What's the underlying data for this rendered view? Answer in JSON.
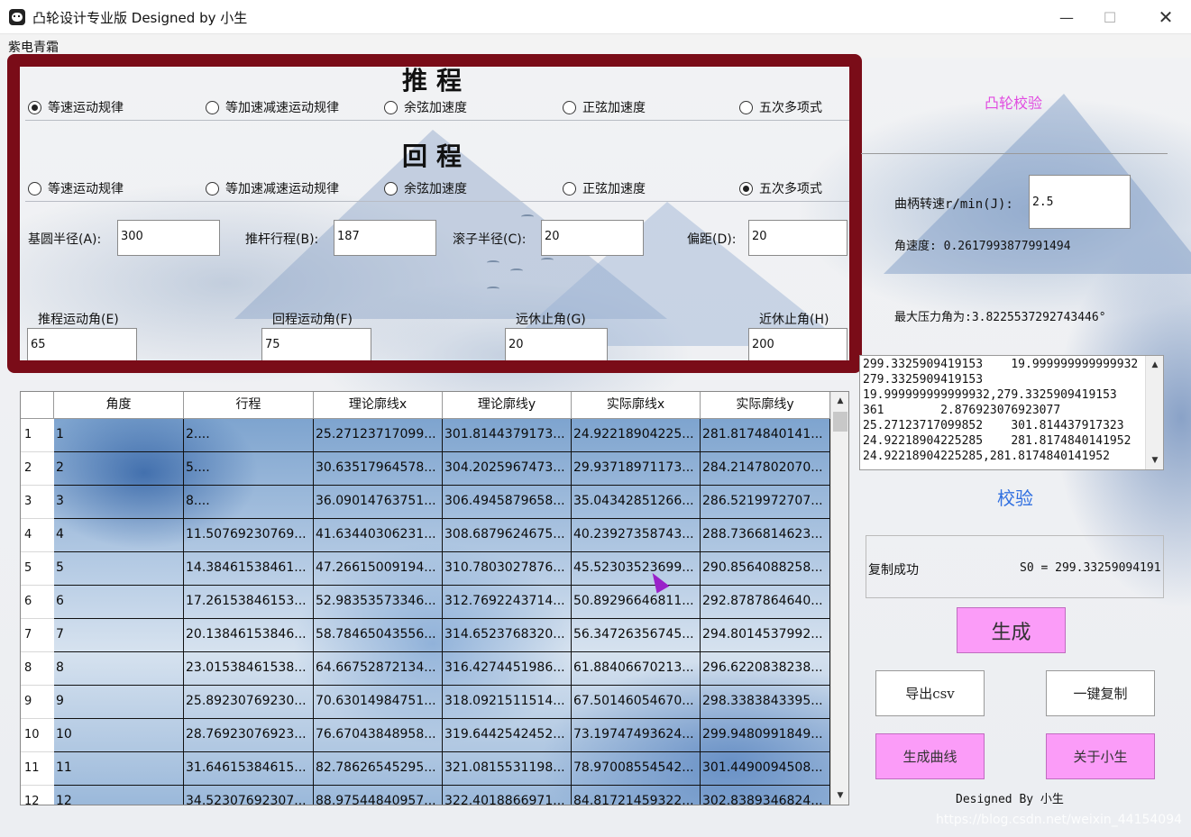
{
  "window": {
    "title": "凸轮设计专业版  Designed by 小生",
    "minimize": "—",
    "maximize": "☐",
    "close": "✕"
  },
  "menu": {
    "item": "紫电青霜"
  },
  "push": {
    "heading": "推程",
    "options": [
      "等速运动规律",
      "等加速减速运动规律",
      "余弦加速度",
      "正弦加速度",
      "五次多项式"
    ],
    "selected": 0
  },
  "return": {
    "heading": "回程",
    "options": [
      "等速运动规律",
      "等加速减速运动规律",
      "余弦加速度",
      "正弦加速度",
      "五次多项式"
    ],
    "selected": 4
  },
  "params": {
    "base_radius_label": "基圆半径(A):",
    "base_radius": "300",
    "stroke_label": "推杆行程(B):",
    "stroke": "187",
    "roller_label": "滚子半径(C):",
    "roller": "20",
    "offset_label": "偏距(D):",
    "offset": "20",
    "push_angle_label": "推程运动角(E)",
    "push_angle": "65",
    "return_angle_label": "回程运动角(F)",
    "return_angle": "75",
    "far_dwell_label": "远休止角(G)",
    "far_dwell": "20",
    "near_dwell_label": "近休止角(H)",
    "near_dwell": "200"
  },
  "table": {
    "columns": [
      "角度",
      "行程",
      "理论廓线x",
      "理论廓线y",
      "实际廓线x",
      "实际廓线y"
    ],
    "rows": [
      [
        "1",
        "1",
        "2....",
        "25.27123717099...",
        "301.8144379173...",
        "24.92218904225...",
        "281.8174840141..."
      ],
      [
        "2",
        "2",
        "5....",
        "30.63517964578...",
        "304.2025967473...",
        "29.93718971173...",
        "284.2147802070..."
      ],
      [
        "3",
        "3",
        "8....",
        "36.09014763751...",
        "306.4945879658...",
        "35.04342851266...",
        "286.5219972707..."
      ],
      [
        "4",
        "4",
        "11.50769230769...",
        "41.63440306231...",
        "308.6879624675...",
        "40.23927358743...",
        "288.7366814623..."
      ],
      [
        "5",
        "5",
        "14.38461538461...",
        "47.26615009194...",
        "310.7803027876...",
        "45.52303523699...",
        "290.8564088258..."
      ],
      [
        "6",
        "6",
        "17.26153846153...",
        "52.98353573346...",
        "312.7692243714...",
        "50.89296646811...",
        "292.8787864640..."
      ],
      [
        "7",
        "7",
        "20.13846153846...",
        "58.78465043556...",
        "314.6523768320...",
        "56.34726356745...",
        "294.8014537992..."
      ],
      [
        "8",
        "8",
        "23.01538461538...",
        "64.66752872134...",
        "316.4274451986...",
        "61.88406670213...",
        "296.6220838238..."
      ],
      [
        "9",
        "9",
        "25.89230769230...",
        "70.63014984751...",
        "318.0921511514...",
        "67.50146054670...",
        "298.3383843395..."
      ],
      [
        "10",
        "10",
        "28.76923076923...",
        "76.67043848958...",
        "319.6442542452...",
        "73.19747493624...",
        "299.9480991849..."
      ],
      [
        "11",
        "11",
        "31.64615384615...",
        "82.78626545295...",
        "321.0815531198...",
        "78.97008554542...",
        "301.4490094508..."
      ],
      [
        "12",
        "12",
        "34.52307692307...",
        "88.97544840957...",
        "322.4018866971...",
        "84.81721459322...",
        "302.8389346824..."
      ]
    ]
  },
  "right": {
    "check_title": "凸轮校验",
    "speed_label": "曲柄转速r/min(J):",
    "speed_value": "2.5",
    "angular_velocity": "角速度: 0.2617993877991494",
    "max_pressure": "最大压力角为:3.8225537292743446°",
    "list_lines": [
      "299.3325909419153    19.999999999999932",
      "279.3325909419153",
      "19.999999999999932,279.3325909419153",
      "361        2.876923076923077",
      "25.27123717099852    301.814437917323",
      "24.92218904225285    281.8174840141952",
      "24.92218904225285,281.8174840141952"
    ],
    "verify_title": "校验",
    "copy_status": "复制成功",
    "s0": "S0 = 299.33259094191",
    "generate": "生成",
    "export_csv": "导出csv",
    "copy_all": "一键复制",
    "gen_curve": "生成曲线",
    "about": "关于小生",
    "signature": "Designed By 小生"
  },
  "watermark": "https://blog.csdn.net/weixin_44154094"
}
